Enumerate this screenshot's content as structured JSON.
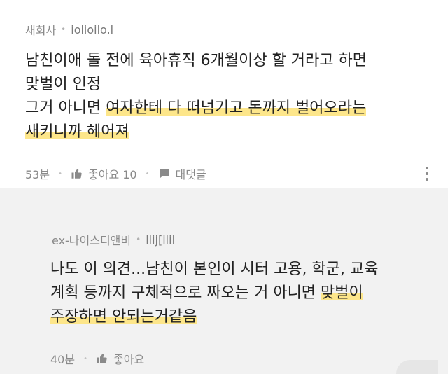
{
  "comments": [
    {
      "author": "새회사",
      "nickname": "iolioilo.l",
      "lines": [
        [
          {
            "text": "남친이애 돌 전에 육아휴직 6개월이상 할 거라고 하면",
            "hl": false
          }
        ],
        [
          {
            "text": "맞벌이 인정",
            "hl": false
          }
        ],
        [
          {
            "text": "그거 아니면 ",
            "hl": false
          },
          {
            "text": "여자한테 다 떠넘기고 돈까지 벌어오라는",
            "hl": true
          }
        ],
        [
          {
            "text": "새키니까 헤어져",
            "hl": true
          }
        ]
      ],
      "time": "53분",
      "like_label": "좋아요 10",
      "reply_label": "대댓글"
    },
    {
      "author": "ex-나이스디앤비",
      "nickname": "llij[ilil",
      "lines": [
        [
          {
            "text": "나도 이 의견...남친이 본인이 시터 고용, 학군, 교육",
            "hl": false
          }
        ],
        [
          {
            "text": "계획 등까지 구체적으로 짜오는 거 아니면 ",
            "hl": false
          },
          {
            "text": "맞벌이",
            "hl": true
          }
        ],
        [
          {
            "text": "주장하면 안되는거같음",
            "hl": true
          }
        ]
      ],
      "time": "40분",
      "like_label": "좋아요"
    }
  ],
  "icons": {
    "like": "thumbs-up-icon",
    "reply": "speech-bubble-icon",
    "more": "more-vertical-icon",
    "reply_arrow": "reply-arrow-icon"
  },
  "colors": {
    "highlight": "#fde68a",
    "reply_bg": "#f2f2f2"
  }
}
